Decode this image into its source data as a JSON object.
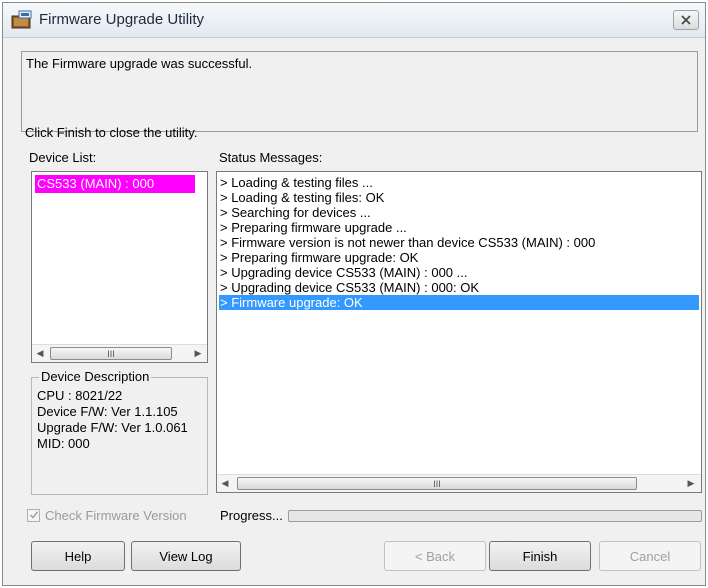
{
  "window": {
    "title": "Firmware Upgrade Utility"
  },
  "message": {
    "line1": "The Firmware upgrade was successful.",
    "line2": "Click Finish to close the utility."
  },
  "device_list": {
    "label": "Device List:",
    "items": [
      "CS533 (MAIN) : 000"
    ],
    "selected_color": "#ff00ff"
  },
  "status": {
    "label": "Status Messages:",
    "items": [
      "> Loading & testing files ...",
      "> Loading & testing files: OK",
      "> Searching for devices ...",
      "> Preparing firmware upgrade ...",
      "> Firmware version is not newer than device CS533 (MAIN) : 000",
      "> Preparing firmware upgrade: OK",
      "> Upgrading device CS533 (MAIN) : 000 ...",
      "> Upgrading device CS533 (MAIN) : 000: OK",
      "> Firmware upgrade: OK"
    ],
    "selected_color": "#3399ff"
  },
  "device_description": {
    "legend": "Device Description",
    "cpu": "CPU : 8021/22",
    "device_fw": "Device F/W: Ver 1.1.105",
    "upgrade_fw": "Upgrade F/W: Ver 1.0.061",
    "mid": "MID: 000"
  },
  "check_firmware": {
    "label": "Check Firmware Version",
    "checked": true,
    "enabled": false
  },
  "progress": {
    "label": "Progress...",
    "value": 0
  },
  "scrollbar_grip": "III",
  "buttons": {
    "help": "Help",
    "view_log": "View Log",
    "back": "< Back",
    "finish": "Finish",
    "cancel": "Cancel"
  },
  "icons": {
    "app": "firmware-app-icon",
    "close": "close-icon",
    "scroll_left": "scroll-left-arrow-icon",
    "scroll_right": "scroll-right-arrow-icon",
    "check": "checkmark-icon"
  }
}
